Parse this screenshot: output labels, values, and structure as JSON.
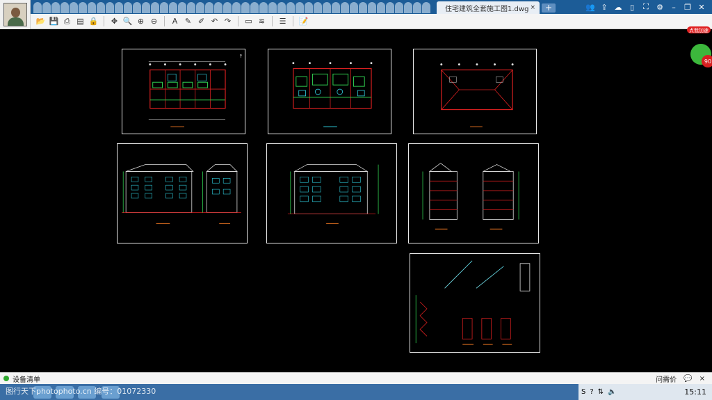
{
  "window": {
    "tab_title": "住宅建筑全套施工图1.dwg",
    "tab_close": "×",
    "new_tab": "+",
    "controls": [
      "people-icon",
      "share-icon",
      "wechat-icon",
      "phone-icon",
      "fullscreen-icon",
      "settings-icon",
      "minimize-icon",
      "restore-icon",
      "close-icon"
    ]
  },
  "toolbar": {
    "groups": [
      [
        "open-icon",
        "save-icon",
        "print-icon",
        "export-pdf-icon",
        "lock-icon"
      ],
      [
        "pan-icon",
        "zoom-realtime-icon",
        "zoom-in-icon",
        "zoom-out-icon"
      ],
      [
        "text-icon",
        "pencil-icon",
        "highlighter-icon",
        "undo-icon",
        "redo-icon"
      ],
      [
        "measure-icon",
        "compare-icon"
      ],
      [
        "layers-icon"
      ],
      [
        "notes-icon"
      ]
    ]
  },
  "badge": {
    "label": "点我加速",
    "value": "90"
  },
  "status_bar": {
    "label": "设备清单",
    "help_label": "问需价",
    "chat_icon": "chat-icon",
    "close": "×"
  },
  "taskbar": {
    "watermark": "图行天下photophoto.cn  编号：01072330",
    "clock": "15:11"
  },
  "colors": {
    "canvas": "#000000",
    "title_bar": "#1c5c97",
    "sheet_border": "#e8e8e8",
    "cad_red": "#d82020",
    "cad_green": "#30d050",
    "cad_cyan": "#30d0e0",
    "cad_white": "#e0e0e0"
  }
}
